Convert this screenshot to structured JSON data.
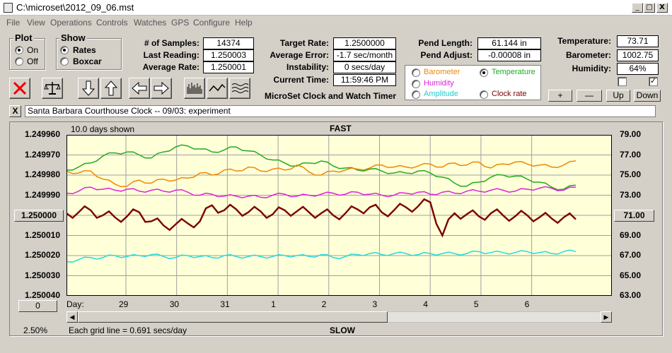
{
  "window": {
    "title": "C:\\microset\\2012_09_06.mst",
    "min": "_",
    "max": "□",
    "close": "X"
  },
  "menu": [
    "File",
    "View",
    "Operations",
    "Controls",
    "Watches",
    "GPS",
    "Configure",
    "Help"
  ],
  "plot_group": {
    "title": "Plot",
    "on": "On",
    "off": "Off"
  },
  "show_group": {
    "title": "Show",
    "rates": "Rates",
    "boxcar": "Boxcar"
  },
  "stats": {
    "samples_label": "# of Samples:",
    "samples": "14374",
    "last_label": "Last Reading:",
    "last": "1.250003",
    "avg_label": "Average Rate:",
    "avg": "1.250001"
  },
  "target": {
    "target_label": "Target Rate:",
    "target": "1.2500000",
    "error_label": "Average Error:",
    "error": "-1.7 sec/month",
    "instability_label": "Instability:",
    "instability": "0 secs/day",
    "time_label": "Current Time:",
    "time": "11:59:46 PM",
    "app_title": "MicroSet Clock and Watch Timer"
  },
  "pend": {
    "length_label": "Pend Length:",
    "length": "61.144 in",
    "adjust_label": "Pend Adjust:",
    "adjust": "-0.00008 in"
  },
  "env": {
    "temp_label": "Temperature:",
    "temp": "73.71",
    "baro_label": "Barometer:",
    "baro": "1002.75",
    "hum_label": "Humidity:",
    "hum": "64%"
  },
  "legend": {
    "barometer": "Barometer",
    "temperature": "Temperature",
    "humidity": "Humidity",
    "amplitude": "Amplitude",
    "clock_rate": "Clock rate"
  },
  "scale_buttons": {
    "plus": "+",
    "minus": "—",
    "up": "Up",
    "down": "Down"
  },
  "watch": {
    "close": "X",
    "name": "Santa Barbara Courthouse Clock   --  09/03: experiment"
  },
  "chart": {
    "days_shown": "10.0 days shown",
    "fast": "FAST",
    "slow": "SLOW",
    "grid_note": "Each grid line = 0.691 secs/day",
    "percent": "2.50%",
    "day_label": "Day:",
    "left_btn": "1.250000",
    "right_btn": "71.00",
    "zero_btn": "0",
    "scroll_left": "◀",
    "scroll_right": "▶"
  },
  "colors": {
    "chart_bg": "#ffffd8",
    "clock_rate": "#7a0000",
    "temperature": "#22aa22",
    "barometer": "#ee8800",
    "humidity": "#dd22dd",
    "amplitude": "#22dddd",
    "grid": "#a0a0a0"
  },
  "chart_data": {
    "type": "line",
    "title": "",
    "x_ticks": [
      "29",
      "30",
      "31",
      "1",
      "2",
      "3",
      "4",
      "5",
      "6"
    ],
    "left_axis_ticks": [
      "1.249960",
      "1.249970",
      "1.249980",
      "1.249990",
      "1.250000",
      "1.250010",
      "1.250020",
      "1.250030",
      "1.250040"
    ],
    "right_axis_ticks": [
      "79.00",
      "77.00",
      "75.00",
      "73.00",
      "71.00",
      "69.00",
      "67.00",
      "65.00",
      "63.00"
    ],
    "left_ylim": [
      1.24996,
      1.25004
    ],
    "right_ylim": [
      63,
      79
    ],
    "x_range_days": 10.0,
    "series": [
      {
        "name": "Temperature",
        "color_key": "temperature",
        "y": [
          75.5,
          75.8,
          76.2,
          76.9,
          77.2,
          77.3,
          77.0,
          76.7,
          77.3,
          77.8,
          77.9,
          77.6,
          77.3,
          77.5,
          77.8,
          77.4,
          77.0,
          76.5,
          76.2,
          75.9,
          76.2,
          76.4,
          75.9,
          75.7,
          75.5,
          75.6,
          75.4,
          75.2,
          75.2,
          75.4,
          75.2,
          74.8,
          74.2,
          73.9,
          74.3,
          74.8,
          75.0,
          74.9,
          74.6,
          74.3,
          73.8,
          73.6,
          74.0
        ]
      },
      {
        "name": "Barometer",
        "color_key": "barometer",
        "y": [
          75.4,
          75.2,
          75.4,
          74.6,
          74.1,
          73.9,
          74.5,
          74.2,
          74.6,
          74.5,
          74.7,
          75.2,
          75.0,
          75.5,
          75.4,
          75.8,
          75.4,
          75.6,
          75.5,
          76.0,
          75.3,
          75.0,
          75.4,
          75.5,
          75.6,
          75.7,
          76.0,
          75.8,
          75.8,
          75.9,
          76.1,
          75.8,
          76.2,
          76.0,
          76.3,
          75.7,
          76.1,
          76.3,
          76.1,
          76.0,
          75.8,
          76.0,
          76.4
        ]
      },
      {
        "name": "Humidity",
        "color_key": "humidity",
        "y": [
          73.2,
          73.4,
          73.8,
          73.6,
          73.5,
          73.6,
          73.4,
          73.5,
          73.4,
          73.5,
          73.3,
          73.0,
          73.1,
          72.9,
          72.9,
          72.9,
          72.8,
          73.0,
          73.1,
          72.9,
          73.0,
          73.1,
          73.2,
          73.1,
          73.3,
          73.1,
          73.0,
          73.0,
          73.2,
          73.3,
          73.1,
          73.3,
          73.2,
          73.4,
          73.4,
          73.5,
          73.5,
          73.4,
          73.6,
          73.7,
          73.7,
          73.5,
          73.8
        ]
      },
      {
        "name": "Amplitude",
        "color_key": "amplitude",
        "y": [
          66.4,
          66.6,
          66.8,
          66.8,
          67.0,
          66.9,
          67.0,
          67.1,
          66.9,
          66.8,
          67.0,
          66.9,
          66.8,
          67.0,
          66.9,
          66.9,
          66.9,
          66.9,
          67.0,
          67.0,
          66.9,
          67.1,
          66.8,
          66.9,
          67.1,
          67.2,
          67.1,
          67.2,
          67.2,
          67.1,
          67.2,
          67.2,
          67.2,
          67.2,
          67.4,
          67.3,
          67.3,
          67.3,
          67.4,
          67.3,
          67.2,
          67.4,
          67.4
        ]
      },
      {
        "name": "Clock rate",
        "color_key": "clock_rate",
        "y": [
          71.2,
          71.3,
          71.5,
          71.0,
          70.8,
          70.9,
          71.3,
          70.4,
          70.0,
          70.1,
          70.2,
          70.4,
          72.0,
          71.5,
          71.6,
          71.3,
          71.4,
          71.1,
          71.5,
          71.4,
          71.3,
          71.2,
          71.0,
          71.2,
          71.6,
          71.8,
          71.3,
          71.5,
          71.8,
          71.9,
          72.3,
          69.0,
          71.2,
          71.1,
          70.9,
          71.2,
          71.0,
          70.9,
          71.0,
          70.8,
          70.7,
          70.8,
          70.6
        ]
      }
    ]
  }
}
